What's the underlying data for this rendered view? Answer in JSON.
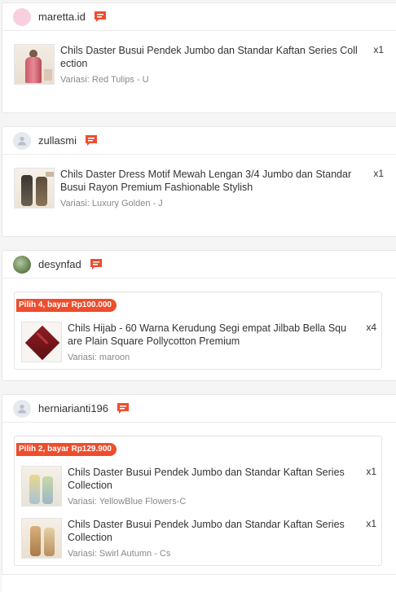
{
  "orders": [
    {
      "username": "maretta.id",
      "avatar": "pink-circle",
      "items": [
        {
          "title": "Chils Daster Busui Pendek Jumbo dan Standar Kaftan Series Collection",
          "variant": "Variasi: Red Tulips - U",
          "qty": "x1"
        }
      ]
    },
    {
      "username": "zullasmi",
      "avatar": "default-user-icon",
      "items": [
        {
          "title": "Chils Daster Dress Motif Mewah Lengan 3/4 Jumbo dan Standar Busui Rayon Premium Fashionable Stylish",
          "variant": "Variasi: Luxury Golden - J",
          "qty": "x1"
        }
      ]
    },
    {
      "username": "desynfad",
      "avatar": "photo",
      "bundle_label": "Pilih 4, bayar Rp100.000",
      "items": [
        {
          "title": "Chils Hijab - 60 Warna Kerudung Segi empat Jilbab Bella Square Plain Square Pollycotton Premium",
          "variant": "Variasi: maroon",
          "qty": "x4"
        }
      ]
    },
    {
      "username": "herniarianti196",
      "avatar": "default-user-icon",
      "bundle_label": "Pilih 2, bayar Rp129.900",
      "items": [
        {
          "title": "Chils Daster Busui Pendek Jumbo dan Standar Kaftan Series Collection",
          "variant": "Variasi: YellowBlue Flowers-C",
          "qty": "x1"
        },
        {
          "title": "Chils Daster Busui Pendek Jumbo dan Standar Kaftan Series Collection",
          "variant": "Variasi: Swirl Autumn - Cs",
          "qty": "x1"
        }
      ]
    }
  ],
  "colors": {
    "accent": "#ee4d2d",
    "border": "#e8e8e8",
    "muted": "#888888"
  }
}
